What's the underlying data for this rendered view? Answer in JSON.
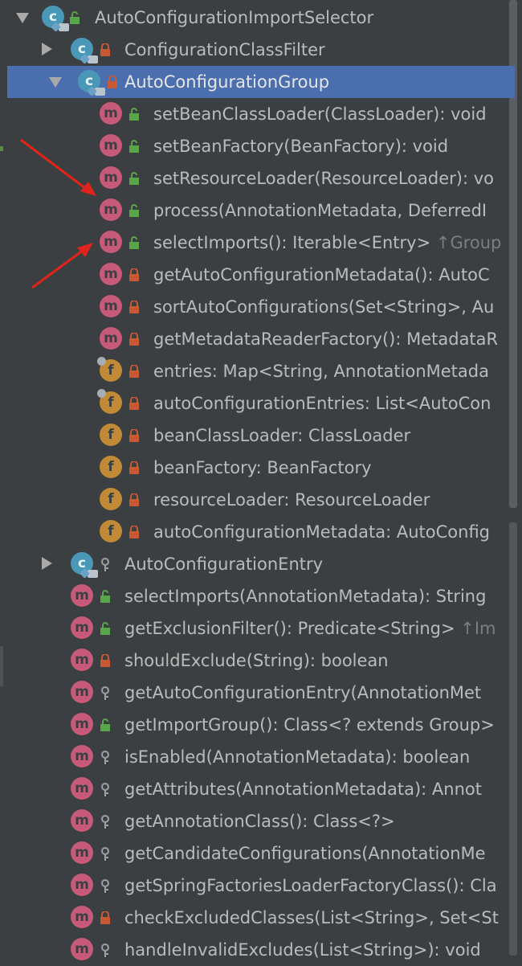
{
  "rows": [
    {
      "label": "AutoConfigurationImportSelector",
      "hint": "",
      "kind": "c",
      "vis": "public",
      "arrow": "down",
      "depth": 0
    },
    {
      "label": "ConfigurationClassFilter",
      "hint": "",
      "kind": "c",
      "vis": "private",
      "arrow": "right",
      "depth": 1
    },
    {
      "label": "AutoConfigurationGroup",
      "hint": "",
      "kind": "c",
      "vis": "private",
      "arrow": "down",
      "depth": 1,
      "selected": true
    },
    {
      "label": "setBeanClassLoader(ClassLoader): void",
      "hint": "",
      "kind": "m",
      "vis": "public",
      "depth": 2
    },
    {
      "label": "setBeanFactory(BeanFactory): void",
      "hint": "",
      "kind": "m",
      "vis": "public",
      "depth": 2
    },
    {
      "label": "setResourceLoader(ResourceLoader): vo",
      "hint": "",
      "kind": "m",
      "vis": "public",
      "depth": 2
    },
    {
      "label": "process(AnnotationMetadata, DeferredI",
      "hint": "",
      "kind": "m",
      "vis": "public",
      "depth": 2
    },
    {
      "label": "selectImports(): Iterable<Entry> ",
      "hint": "↑Group",
      "kind": "m",
      "vis": "public",
      "depth": 2
    },
    {
      "label": "getAutoConfigurationMetadata(): AutoC",
      "hint": "",
      "kind": "m",
      "vis": "private",
      "depth": 2
    },
    {
      "label": "sortAutoConfigurations(Set<String>, Au",
      "hint": "",
      "kind": "m",
      "vis": "private",
      "depth": 2
    },
    {
      "label": "getMetadataReaderFactory(): MetadataR",
      "hint": "",
      "kind": "m",
      "vis": "private",
      "depth": 2
    },
    {
      "label": "entries: Map<String, AnnotationMetada",
      "hint": "",
      "kind": "f",
      "vis": "private",
      "depth": 2,
      "final": true
    },
    {
      "label": "autoConfigurationEntries: List<AutoCon",
      "hint": "",
      "kind": "f",
      "vis": "private",
      "depth": 2,
      "final": true
    },
    {
      "label": "beanClassLoader: ClassLoader",
      "hint": "",
      "kind": "f",
      "vis": "private",
      "depth": 2
    },
    {
      "label": "beanFactory: BeanFactory",
      "hint": "",
      "kind": "f",
      "vis": "private",
      "depth": 2
    },
    {
      "label": "resourceLoader: ResourceLoader",
      "hint": "",
      "kind": "f",
      "vis": "private",
      "depth": 2
    },
    {
      "label": "autoConfigurationMetadata: AutoConfig",
      "hint": "",
      "kind": "f",
      "vis": "private",
      "depth": 2
    },
    {
      "label": "AutoConfigurationEntry",
      "hint": "",
      "kind": "c",
      "vis": "package",
      "arrow": "right",
      "depth": 1
    },
    {
      "label": "selectImports(AnnotationMetadata): String",
      "hint": "",
      "kind": "m",
      "vis": "public",
      "depth": 1
    },
    {
      "label": "getExclusionFilter(): Predicate<String> ",
      "hint": "↑Im",
      "kind": "m",
      "vis": "public",
      "depth": 1
    },
    {
      "label": "shouldExclude(String): boolean",
      "hint": "",
      "kind": "m",
      "vis": "private",
      "depth": 1
    },
    {
      "label": "getAutoConfigurationEntry(AnnotationMet",
      "hint": "",
      "kind": "m",
      "vis": "package",
      "depth": 1
    },
    {
      "label": "getImportGroup(): Class<? extends Group>",
      "hint": "",
      "kind": "m",
      "vis": "public",
      "depth": 1
    },
    {
      "label": "isEnabled(AnnotationMetadata): boolean",
      "hint": "",
      "kind": "m",
      "vis": "package",
      "depth": 1
    },
    {
      "label": "getAttributes(AnnotationMetadata): Annot",
      "hint": "",
      "kind": "m",
      "vis": "package",
      "depth": 1
    },
    {
      "label": "getAnnotationClass(): Class<?>",
      "hint": "",
      "kind": "m",
      "vis": "package",
      "depth": 1
    },
    {
      "label": "getCandidateConfigurations(AnnotationMe",
      "hint": "",
      "kind": "m",
      "vis": "package",
      "depth": 1
    },
    {
      "label": "getSpringFactoriesLoaderFactoryClass(): Cla",
      "hint": "",
      "kind": "m",
      "vis": "package",
      "depth": 1
    },
    {
      "label": "checkExcludedClasses(List<String>, Set<St",
      "hint": "",
      "kind": "m",
      "vis": "private",
      "depth": 1
    },
    {
      "label": "handleInvalidExcludes(List<String>): void",
      "hint": "",
      "kind": "m",
      "vis": "package",
      "depth": 1
    }
  ],
  "icons": {
    "m": "m",
    "f": "f",
    "c": "c"
  },
  "colors": {
    "background": "#3c3f41",
    "selection": "#4b6eaf",
    "method": "#c7597a",
    "field": "#c08a37",
    "class": "#4a98b8",
    "public": "#57a64a",
    "private": "#c75a32",
    "annotation_arrow": "#e0241b"
  }
}
